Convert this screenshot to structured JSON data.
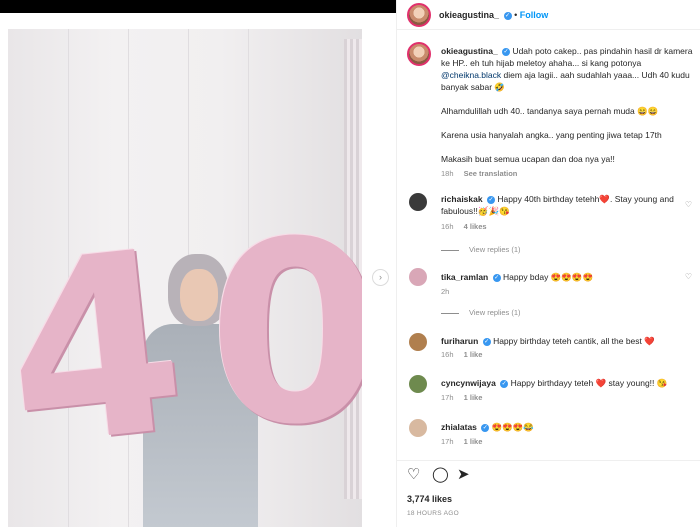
{
  "post": {
    "username": "okieagustina_",
    "follow_label": "Follow",
    "more_label": "•••",
    "caption_lines": [
      "Udah poto cakep.. pas pindahin hasil dr kamera",
      "ke HP.. eh tuh hijab meletoy ahaha... si kang potonya",
      "diem aja lagii.. aah sudahlah yaaa... Udh 40 kudu",
      "banyak sabar 🤣"
    ],
    "caption_mention": "@cheikna.black",
    "caption_p2": "Alhamdulillah udh 40.. tandanya saya pernah muda 😄😄",
    "caption_p3": "Karena usia hanyalah angka.. yang penting jiwa tetap 17th",
    "caption_p4": "Makasih buat semua ucapan dan doa nya ya!!",
    "caption_time": "18h",
    "see_translation": "See translation",
    "likes": "3,774 likes",
    "posted": "18 HOURS AGO"
  },
  "comments": [
    {
      "user": "richaiskak",
      "text_1": "Happy 40th birthday tetehh❤️. Stay young and",
      "text_2": "fabulous!!🥳🎉😘",
      "time": "16h",
      "likes": "4 likes",
      "replies": "View replies (1)"
    },
    {
      "user": "tika_ramlan",
      "text_1": "Happy bday 😍😍😍😍",
      "time": "2h",
      "replies": "View replies (1)"
    },
    {
      "user": "furiharun",
      "text_1": "Happy birthday teteh cantik, all the best ❤️",
      "time": "16h",
      "likes": "1 like"
    },
    {
      "user": "cyncynwijaya",
      "text_1": "Happy birthdayy teteh ❤️ stay young!! 😘",
      "time": "17h",
      "likes": "1 like"
    },
    {
      "user": "zhialatas",
      "text_1": "😍😍😍😂",
      "time": "17h",
      "likes": "1 like"
    }
  ],
  "icons": {
    "next": "chevron-right-icon",
    "like": "heart-icon",
    "comment": "comment-icon",
    "share": "send-icon",
    "verified": "verified-badge-icon"
  },
  "colors": {
    "follow": "#0095f6",
    "verified": "#3897f0",
    "muted": "#8e8e8e"
  }
}
